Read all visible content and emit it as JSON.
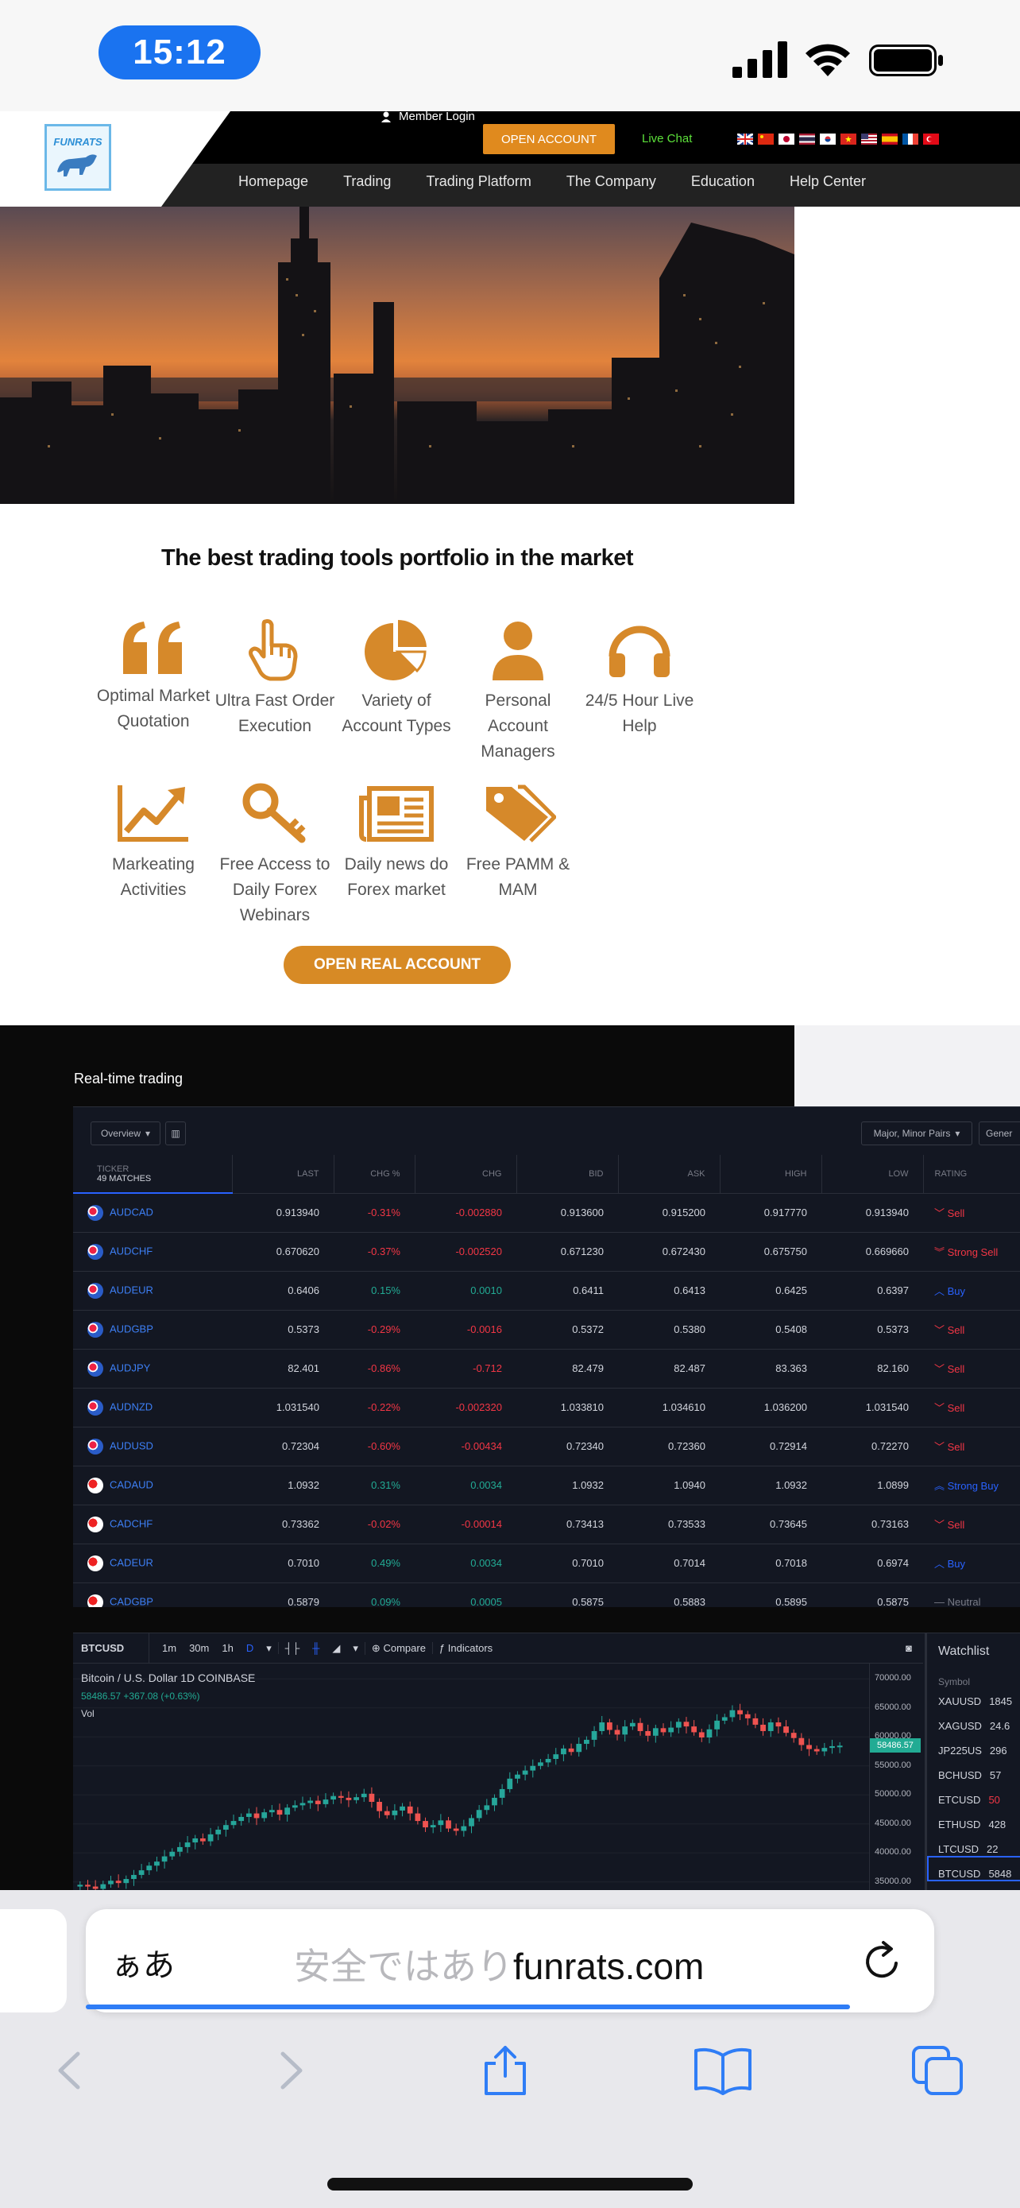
{
  "status_bar": {
    "time": "15:12"
  },
  "header": {
    "logo_text": "FUNRATS",
    "member_login": "Member Login",
    "open_account": "OPEN ACCOUNT",
    "live_chat": "Live Chat",
    "nav": [
      "Homepage",
      "Trading",
      "Trading Platform",
      "The Company",
      "Education",
      "Help Center"
    ]
  },
  "features": {
    "title": "The best trading tools portfolio in the market",
    "items": [
      {
        "label": "Optimal Market Quotation",
        "icon": "quote-icon"
      },
      {
        "label": "Ultra Fast Order Execution",
        "icon": "pointer-hand-icon"
      },
      {
        "label": "Variety of Account Types",
        "icon": "pie-chart-icon"
      },
      {
        "label": "Personal Account Managers",
        "icon": "user-icon"
      },
      {
        "label": "24/5 Hour Live Help",
        "icon": "headset-icon"
      },
      {
        "label": "Markeating Activities",
        "icon": "line-chart-icon"
      },
      {
        "label": "Free Access to Daily Forex Webinars",
        "icon": "key-icon"
      },
      {
        "label": "Daily news do Forex market",
        "icon": "newspaper-icon"
      },
      {
        "label": "Free PAMM & MAM",
        "icon": "tags-icon"
      }
    ],
    "cta": "OPEN REAL ACCOUNT"
  },
  "realtime": {
    "label": "Real-time trading",
    "toolbar": {
      "overview": "Overview",
      "pairs": "Major, Minor Pairs",
      "general": "Gener"
    },
    "columns": [
      "LAST",
      "CHG %",
      "CHG",
      "BID",
      "ASK",
      "HIGH",
      "LOW",
      "RATING"
    ],
    "ticker_header": "TICKER",
    "matches": "49 MATCHES",
    "rows": [
      {
        "ticker": "AUDCAD",
        "last": "0.913940",
        "chgp": "-0.31%",
        "chg": "-0.002880",
        "bid": "0.913600",
        "ask": "0.915200",
        "high": "0.917770",
        "low": "0.913940",
        "rating": "Sell"
      },
      {
        "ticker": "AUDCHF",
        "last": "0.670620",
        "chgp": "-0.37%",
        "chg": "-0.002520",
        "bid": "0.671230",
        "ask": "0.672430",
        "high": "0.675750",
        "low": "0.669660",
        "rating": "Strong Sell"
      },
      {
        "ticker": "AUDEUR",
        "last": "0.6406",
        "chgp": "0.15%",
        "chg": "0.0010",
        "bid": "0.6411",
        "ask": "0.6413",
        "high": "0.6425",
        "low": "0.6397",
        "rating": "Buy"
      },
      {
        "ticker": "AUDGBP",
        "last": "0.5373",
        "chgp": "-0.29%",
        "chg": "-0.0016",
        "bid": "0.5372",
        "ask": "0.5380",
        "high": "0.5408",
        "low": "0.5373",
        "rating": "Sell"
      },
      {
        "ticker": "AUDJPY",
        "last": "82.401",
        "chgp": "-0.86%",
        "chg": "-0.712",
        "bid": "82.479",
        "ask": "82.487",
        "high": "83.363",
        "low": "82.160",
        "rating": "Sell"
      },
      {
        "ticker": "AUDNZD",
        "last": "1.031540",
        "chgp": "-0.22%",
        "chg": "-0.002320",
        "bid": "1.033810",
        "ask": "1.034610",
        "high": "1.036200",
        "low": "1.031540",
        "rating": "Sell"
      },
      {
        "ticker": "AUDUSD",
        "last": "0.72304",
        "chgp": "-0.60%",
        "chg": "-0.00434",
        "bid": "0.72340",
        "ask": "0.72360",
        "high": "0.72914",
        "low": "0.72270",
        "rating": "Sell"
      },
      {
        "ticker": "CADAUD",
        "last": "1.0932",
        "chgp": "0.31%",
        "chg": "0.0034",
        "bid": "1.0932",
        "ask": "1.0940",
        "high": "1.0932",
        "low": "1.0899",
        "rating": "Strong Buy"
      },
      {
        "ticker": "CADCHF",
        "last": "0.73362",
        "chgp": "-0.02%",
        "chg": "-0.00014",
        "bid": "0.73413",
        "ask": "0.73533",
        "high": "0.73645",
        "low": "0.73163",
        "rating": "Sell"
      },
      {
        "ticker": "CADEUR",
        "last": "0.7010",
        "chgp": "0.49%",
        "chg": "0.0034",
        "bid": "0.7010",
        "ask": "0.7014",
        "high": "0.7018",
        "low": "0.6974",
        "rating": "Buy"
      },
      {
        "ticker": "CADGBP",
        "last": "0.5879",
        "chgp": "0.09%",
        "chg": "0.0005",
        "bid": "0.5875",
        "ask": "0.5883",
        "high": "0.5895",
        "low": "0.5875",
        "rating": "Neutral"
      }
    ]
  },
  "chart_widget": {
    "symbol": "BTCUSD",
    "intervals": [
      "1m",
      "30m",
      "1h",
      "D"
    ],
    "compare": "Compare",
    "indicators": "Indicators",
    "title": "Bitcoin / U.S. Dollar  1D  COINBASE",
    "price_line": "58486.57 +367.08 (+0.63%)",
    "vol": "Vol",
    "last_price": "58486.57",
    "y_ticks": [
      "70000.00",
      "65000.00",
      "60000.00",
      "55000.00",
      "50000.00",
      "45000.00",
      "40000.00",
      "35000.00"
    ],
    "watchlist": {
      "title": "Watchlist",
      "header": "Symbol",
      "rows": [
        {
          "symbol": "XAUUSD",
          "price": "1845"
        },
        {
          "symbol": "XAGUSD",
          "price": "24.6"
        },
        {
          "symbol": "JP225US",
          "price": "296"
        },
        {
          "symbol": "BCHUSD",
          "price": "57"
        },
        {
          "symbol": "ETCUSD",
          "price": "50"
        },
        {
          "symbol": "ETHUSD",
          "price": "428"
        },
        {
          "symbol": "LTCUSD",
          "price": "22"
        },
        {
          "symbol": "BTCUSD",
          "price": "5848"
        }
      ]
    }
  },
  "chart_data": {
    "type": "line",
    "title": "Bitcoin / U.S. Dollar  1D  COINBASE",
    "xlabel": "",
    "ylabel": "",
    "ylim": [
      34000,
      71000
    ],
    "x": [
      1,
      2,
      3,
      4,
      5,
      6,
      7,
      8,
      9,
      10,
      11,
      12,
      13,
      14,
      15,
      16,
      17,
      18,
      19,
      20,
      21,
      22,
      23,
      24,
      25,
      26,
      27,
      28,
      29,
      30,
      31,
      32,
      33,
      34,
      35,
      36,
      37,
      38,
      39,
      40,
      41,
      42,
      43,
      44,
      45,
      46,
      47,
      48,
      49,
      50,
      51,
      52,
      53,
      54,
      55,
      56,
      57,
      58,
      59,
      60,
      61,
      62,
      63,
      64,
      65,
      66,
      67,
      68,
      69,
      70,
      71,
      72,
      73,
      74,
      75,
      76,
      77,
      78,
      79,
      80,
      81,
      82,
      83,
      84,
      85,
      86,
      87,
      88,
      89,
      90,
      91,
      92,
      93,
      94,
      95,
      96,
      97,
      98,
      99,
      100
    ],
    "series": [
      {
        "values": [
          34500,
          34200,
          33800,
          34600,
          35200,
          34800,
          35500,
          36200,
          37000,
          37800,
          38500,
          39400,
          40200,
          41000,
          41800,
          42500,
          42000,
          43200,
          44000,
          44800,
          45500,
          46200,
          46800,
          46000,
          47000,
          47400,
          46600,
          47800,
          48200,
          48600,
          49000,
          48400,
          49200,
          49800,
          49500,
          49100,
          49600,
          50200,
          48800,
          47200,
          46500,
          47300,
          48000,
          46800,
          45500,
          44400,
          44800,
          45600,
          44200,
          43800,
          44600,
          46000,
          47400,
          48200,
          49500,
          51000,
          52800,
          53500,
          54200,
          55000,
          55600,
          56200,
          57000,
          58000,
          57400,
          58800,
          59500,
          61000,
          62500,
          61200,
          60400,
          61800,
          62400,
          61000,
          60200,
          61500,
          60800,
          61600,
          62600,
          61800,
          60800,
          59900,
          61300,
          62800,
          63400,
          64600,
          63900,
          63200,
          62100,
          61000,
          62500,
          61800,
          60700,
          59800,
          58600,
          57900,
          57500,
          58100,
          58400,
          58487
        ]
      }
    ]
  },
  "safari": {
    "aa": "ぁあ",
    "url_ghost": "安全ではあり",
    "url": "funrats.com"
  }
}
